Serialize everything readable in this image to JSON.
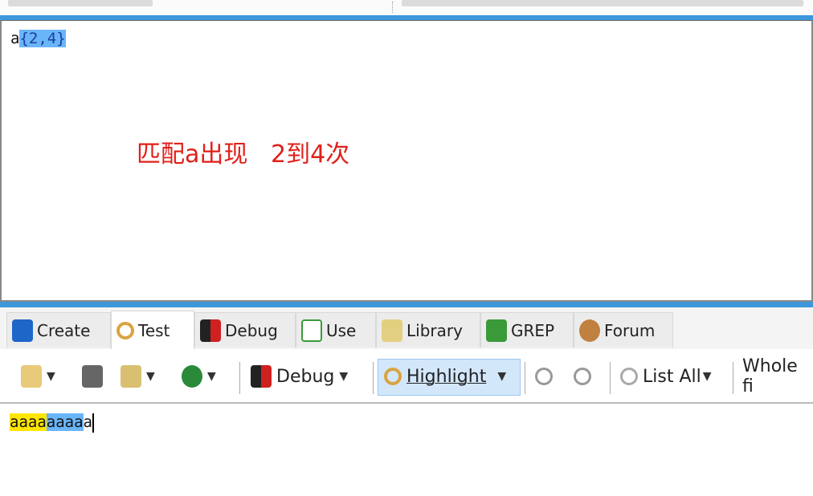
{
  "regex": {
    "literal": "a",
    "quantifier": "{2,4}"
  },
  "annotation": "匹配a出现   2到4次",
  "tabs": [
    {
      "label": "Create",
      "icon": "create-icon",
      "color": "#1e66c8"
    },
    {
      "label": "Test",
      "icon": "magnifier-icon",
      "color": "#d9a441"
    },
    {
      "label": "Debug",
      "icon": "debug-bug-icon",
      "color": "#d02020"
    },
    {
      "label": "Use",
      "icon": "use-icon",
      "color": "#3a9a3a"
    },
    {
      "label": "Library",
      "icon": "library-icon",
      "color": "#d8c070"
    },
    {
      "label": "GREP",
      "icon": "grep-icon",
      "color": "#3a9a3a"
    },
    {
      "label": "Forum",
      "icon": "forum-icon",
      "color": "#c08040"
    }
  ],
  "toolbar": {
    "debug": "Debug",
    "highlight": "Highlight",
    "list_all": "List All",
    "whole": "Whole fi"
  },
  "subject": {
    "match1": "aaaa",
    "match2": "aaaa",
    "rest": "a"
  },
  "colors": {
    "accent": "#3d97da",
    "match1": "#ffe600",
    "match2": "#6ab5f8",
    "annotation": "#e0201a"
  }
}
